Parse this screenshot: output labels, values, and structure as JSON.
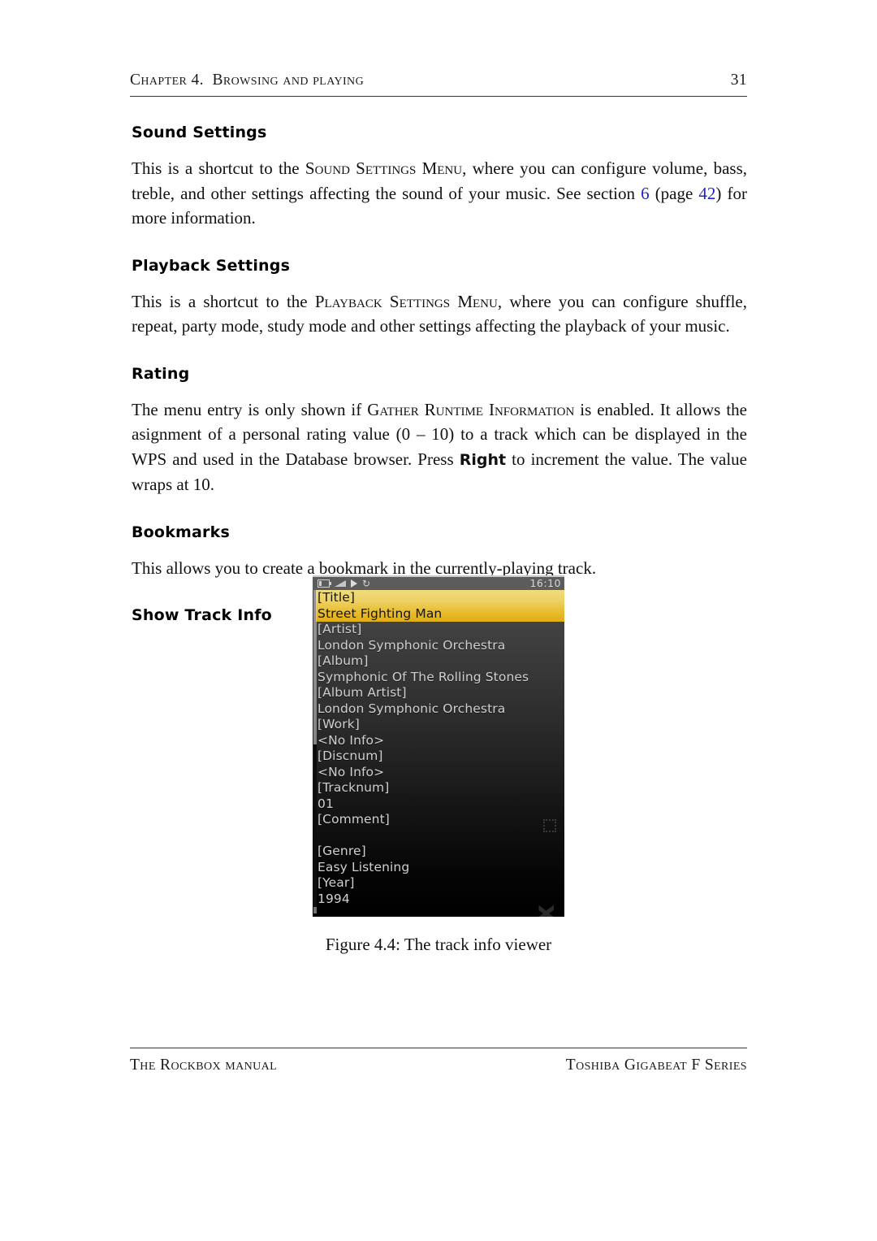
{
  "header": {
    "chapter": "Chapter 4.  Browsing and playing",
    "page_number": "31"
  },
  "sections": {
    "sound_settings": {
      "heading": "Sound Settings",
      "text_1": "This is a shortcut to the ",
      "menu_name": "Sound Settings Menu",
      "text_2": ", where you can configure volume, bass, treble, and other settings affecting the sound of your music. See section ",
      "link_section": "6",
      "text_3": " (page ",
      "link_page": "42",
      "text_4": ") for more information."
    },
    "playback_settings": {
      "heading": "Playback Settings",
      "text_1": "This is a shortcut to the ",
      "menu_name": "Playback Settings Menu",
      "text_2": ", where you can configure shuffle, repeat, party mode, study mode and other settings affecting the playback of your music."
    },
    "rating": {
      "heading": "Rating",
      "text_1": "The menu entry is only shown if ",
      "setting_name": "Gather Runtime Information",
      "text_2": " is enabled. It allows the asignment of a personal rating value (0 – 10) to a track which can be displayed in the WPS and used in the Database browser. Press ",
      "key_name": "Right",
      "text_3": " to increment the value. The value wraps at 10."
    },
    "bookmarks": {
      "heading": "Bookmarks",
      "text_1": "This allows you to create a bookmark in the currently-playing track."
    },
    "show_track_info": {
      "heading": "Show Track Info"
    }
  },
  "figure": {
    "caption": "Figure 4.4: The track info viewer",
    "device_screen": {
      "statusbar": {
        "time": "16:10",
        "icons": [
          "battery-icon",
          "volume-icon",
          "play-icon",
          "repeat-icon"
        ]
      },
      "watermark": "ROCKbox",
      "rows": [
        {
          "text": "[Title]",
          "selected": true
        },
        {
          "text": "Street Fighting Man",
          "selected": true
        },
        {
          "text": "[Artist]",
          "selected": false
        },
        {
          "text": "London Symphonic Orchestra",
          "selected": false
        },
        {
          "text": "[Album]",
          "selected": false
        },
        {
          "text": "Symphonic Of The Rolling Stones",
          "selected": false
        },
        {
          "text": "[Album Artist]",
          "selected": false
        },
        {
          "text": "London Symphonic Orchestra",
          "selected": false
        },
        {
          "text": "[Work]",
          "selected": false
        },
        {
          "text": "<No Info>",
          "selected": false
        },
        {
          "text": "[Discnum]",
          "selected": false
        },
        {
          "text": "<No Info>",
          "selected": false
        },
        {
          "text": "[Tracknum]",
          "selected": false
        },
        {
          "text": "01",
          "selected": false
        },
        {
          "text": "[Comment]",
          "selected": false
        },
        {
          "text": "",
          "selected": false
        },
        {
          "text": "[Genre]",
          "selected": false
        },
        {
          "text": "Easy Listening",
          "selected": false
        },
        {
          "text": "[Year]",
          "selected": false
        },
        {
          "text": "1994",
          "selected": false
        }
      ]
    }
  },
  "footer": {
    "left": "The Rockbox manual",
    "right": "Toshiba Gigabeat F Series"
  },
  "colors": {
    "link": "#2222cc",
    "selection_gold": "#e8bb2c",
    "statusbar_gray": "#5c5c5c"
  }
}
